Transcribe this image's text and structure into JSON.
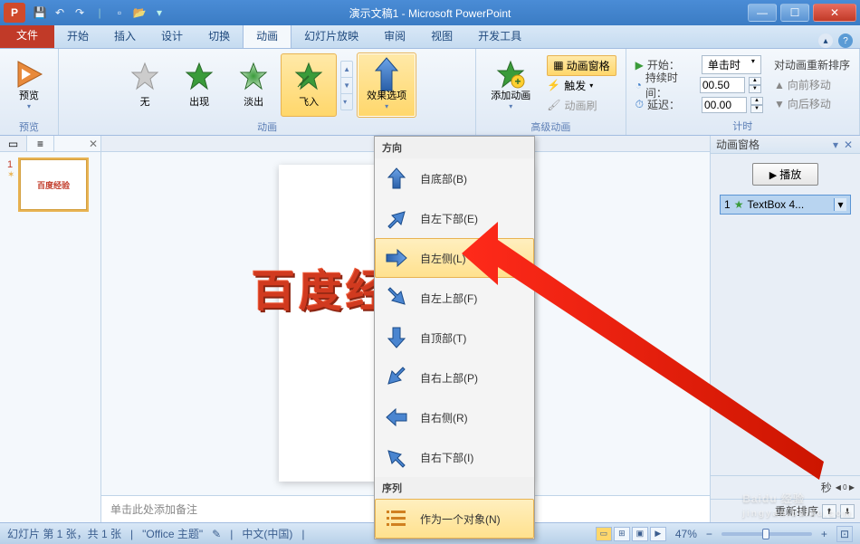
{
  "title": "演示文稿1 - Microsoft PowerPoint",
  "tabs": {
    "file": "文件",
    "home": "开始",
    "insert": "插入",
    "design": "设计",
    "transitions": "切换",
    "animations": "动画",
    "slideshow": "幻灯片放映",
    "review": "审阅",
    "view": "视图",
    "developer": "开发工具"
  },
  "ribbon": {
    "preview": {
      "label": "预览",
      "group": "预览"
    },
    "anim_group": "动画",
    "items": {
      "none": "无",
      "appear": "出现",
      "fade": "淡出",
      "flyin": "飞入"
    },
    "effect_options": "效果选项",
    "add_anim": "添加动画",
    "adv": {
      "pane": "动画窗格",
      "trigger": "触发",
      "painter": "动画刷",
      "group": "高级动画"
    },
    "timing": {
      "start_label": "开始：",
      "start_value": "单击时",
      "duration_label": "持续时间：",
      "duration_value": "00.50",
      "delay_label": "延迟：",
      "delay_value": "00.00",
      "group": "计时"
    },
    "reorder": {
      "title": "对动画重新排序",
      "forward": "向前移动",
      "backward": "向后移动"
    }
  },
  "dropdown": {
    "section_direction": "方向",
    "from_bottom": "自底部(B)",
    "from_bottom_left": "自左下部(E)",
    "from_left": "自左侧(L)",
    "from_top_left": "自左上部(F)",
    "from_top": "自顶部(T)",
    "from_top_right": "自右上部(P)",
    "from_right": "自右侧(R)",
    "from_bottom_right": "自右下部(I)",
    "section_sequence": "序列",
    "as_one": "作为一个对象(N)"
  },
  "anim_pane": {
    "title": "动画窗格",
    "play": "播放",
    "item_num": "1",
    "item_text": "TextBox 4...",
    "seconds": "秒",
    "reorder": "重新排序"
  },
  "slide_panel": {
    "num": "1",
    "thumb_text": "百度经验"
  },
  "canvas": {
    "text": "百度经验"
  },
  "notes_placeholder": "单击此处添加备注",
  "status": {
    "slide": "幻灯片 第 1 张，共 1 张",
    "theme": "\"Office 主题\"",
    "lang": "中文(中国)",
    "zoom": "47%"
  },
  "watermark": {
    "brand": "Baidu 经验",
    "url": "jingyan.baidu.com"
  }
}
